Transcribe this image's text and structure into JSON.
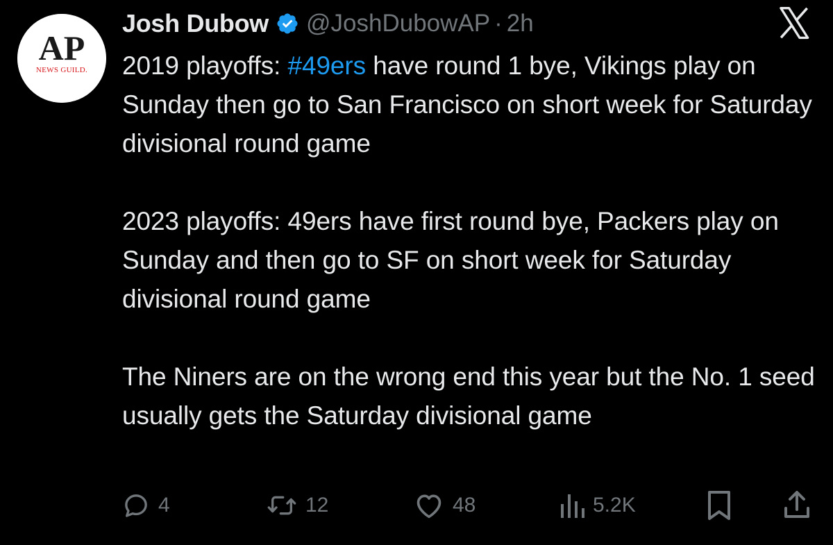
{
  "tweet": {
    "author": {
      "display_name": "Josh Dubow",
      "handle": "@JoshDubowAP",
      "separator": "·",
      "time": "2h",
      "verified": true,
      "avatar": {
        "logo_text": "AP",
        "sub_text": "NEWS GUILD."
      }
    },
    "paragraphs": [
      {
        "prefix": "2019 playoffs: ",
        "hashtag": "#49ers",
        "suffix": " have round 1 bye, Vikings play on Sunday then go to San Francisco on short week for Saturday divisional round game"
      },
      {
        "text": "2023 playoffs: 49ers have first round bye, Packers play on Sunday and then go to SF on short week for Saturday divisional round game"
      },
      {
        "text": "The Niners are on the wrong end this year but the No. 1 seed usually gets the Saturday divisional game"
      }
    ],
    "actions": {
      "reply": {
        "icon": "reply-icon",
        "count": "4"
      },
      "retweet": {
        "icon": "retweet-icon",
        "count": "12"
      },
      "like": {
        "icon": "heart-icon",
        "count": "48"
      },
      "views": {
        "icon": "views-icon",
        "count": "5.2K"
      },
      "bookmark": {
        "icon": "bookmark-icon"
      },
      "share": {
        "icon": "share-icon"
      }
    }
  },
  "brand": {
    "platform_icon": "x-logo-icon"
  },
  "colors": {
    "background": "#000000",
    "primary_text": "#e7e9ea",
    "secondary_text": "#71767b",
    "link": "#1d9bf0",
    "verified": "#1d9bf0",
    "ap_red": "#d9161c",
    "ap_black": "#1a1a1a"
  }
}
